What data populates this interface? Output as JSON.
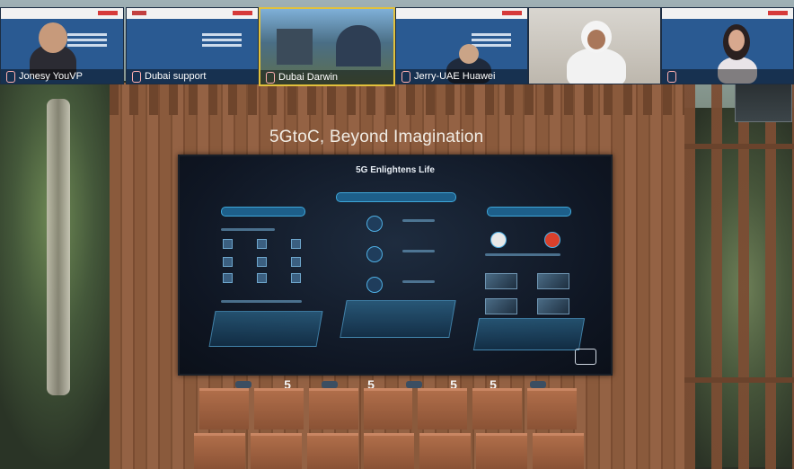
{
  "participants": [
    {
      "name": "Jonesy YouVP",
      "camera": "on"
    },
    {
      "name": "Dubai support",
      "camera": "slide"
    },
    {
      "name": "Dubai Darwin",
      "camera": "scene"
    },
    {
      "name": "Jerry-UAE Huawei",
      "camera": "on"
    },
    {
      "name": "",
      "camera": "on"
    },
    {
      "name": "",
      "camera": "on"
    }
  ],
  "stage": {
    "headline": "5GtoC, Beyond Imagination",
    "screen_title": "5G Enlightens Life",
    "podium_number_label": "5"
  },
  "colors": {
    "tile_blue": "#2a5a92",
    "active_border": "#e2c13c",
    "wood": "#8a5a3c"
  },
  "icons": [
    "mic-icon",
    "camera-icon"
  ]
}
